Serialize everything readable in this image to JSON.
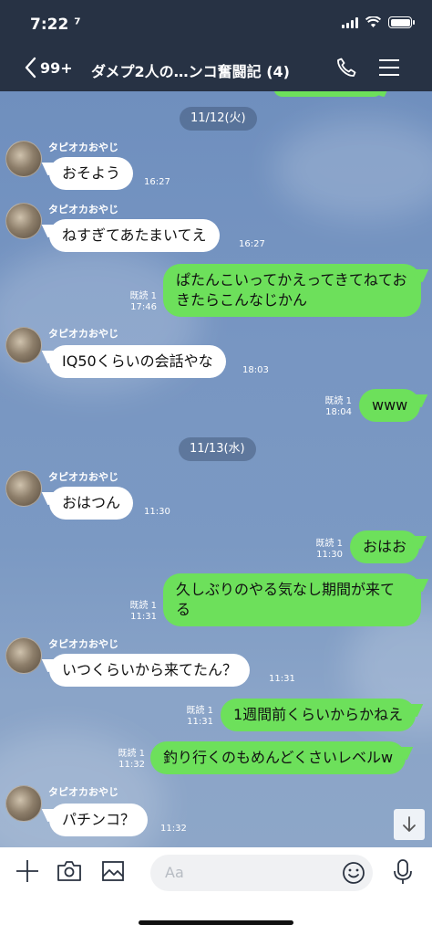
{
  "status": {
    "time": "7:22 ⁷"
  },
  "header": {
    "back_count": "99+",
    "title": "ダメプ2人の…ンコ奮闘記 (4)"
  },
  "dates": [
    "11/12(火)",
    "11/13(水)"
  ],
  "sender_name": "タピオカおやじ",
  "messages": [
    {
      "side": "in",
      "text": "おそよう",
      "time": "16:27"
    },
    {
      "side": "in",
      "text": "ねすぎてあたまいてえ",
      "time": "16:27"
    },
    {
      "side": "out",
      "text": "ぱたんこいってかえってきてねておきたらこんなじかん",
      "read": "既読 1",
      "time": "17:46"
    },
    {
      "side": "in",
      "text": "IQ50くらいの会話やな",
      "time": "18:03"
    },
    {
      "side": "out",
      "text": "www",
      "read": "既読 1",
      "time": "18:04"
    },
    {
      "side": "in",
      "text": "おはつん",
      "time": "11:30"
    },
    {
      "side": "out",
      "text": "おはお",
      "read": "既読 1",
      "time": "11:30"
    },
    {
      "side": "out",
      "text": "久しぶりのやる気なし期間が来てる",
      "read": "既読 1",
      "time": "11:31"
    },
    {
      "side": "in",
      "text": "いつくらいから来てたん？",
      "time": "11:31"
    },
    {
      "side": "out",
      "text": "1週間前くらいからかねえ",
      "read": "既読 1",
      "time": "11:31"
    },
    {
      "side": "out",
      "text": "釣り行くのもめんどくさいレベルw",
      "read": "既読 1",
      "time": "11:32"
    },
    {
      "side": "in",
      "text": "パチンコ？",
      "time": "11:32"
    }
  ],
  "input": {
    "placeholder": "Aa"
  },
  "icons": [
    "chevron-left-icon",
    "phone-icon",
    "menu-icon",
    "plus-icon",
    "camera-icon",
    "image-icon",
    "emoji-icon",
    "mic-icon",
    "arrow-down-icon"
  ],
  "colors": {
    "header_bg": "#273244",
    "bubble_out": "#6de05b",
    "bubble_in": "#ffffff"
  }
}
